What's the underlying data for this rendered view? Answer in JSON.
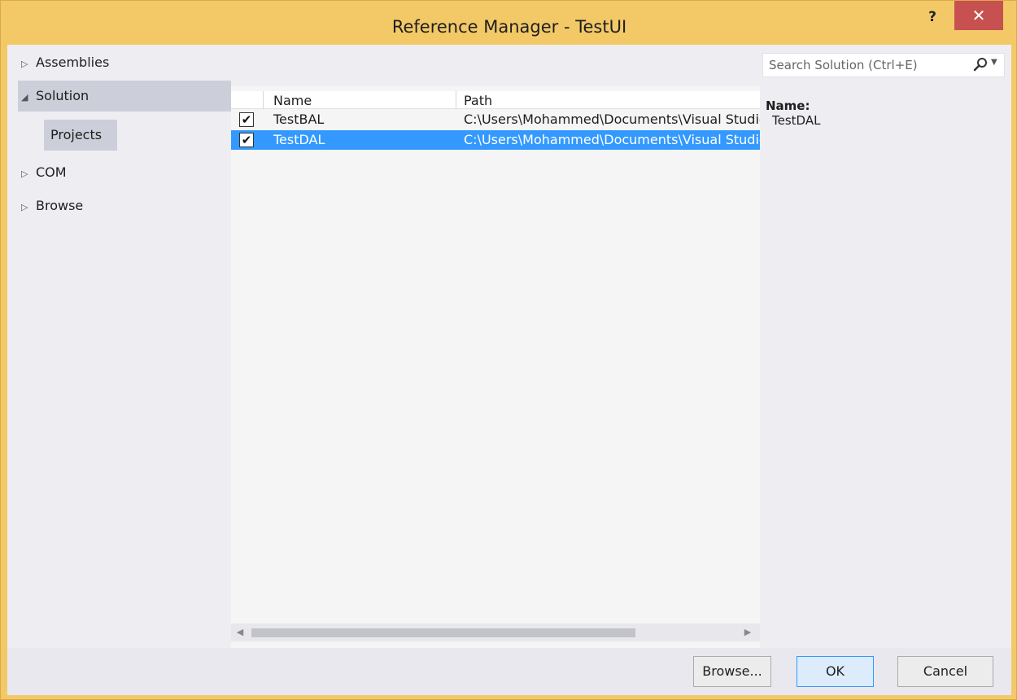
{
  "window": {
    "title": "Reference Manager - TestUI",
    "help_label": "?",
    "close_label": "✕"
  },
  "nav": {
    "assemblies": {
      "arrow": "▷",
      "label": "Assemblies"
    },
    "solution": {
      "arrow": "◢",
      "label": "Solution"
    },
    "projects": {
      "label": "Projects"
    },
    "com": {
      "arrow": "▷",
      "label": "COM"
    },
    "browse": {
      "arrow": "▷",
      "label": "Browse"
    }
  },
  "list": {
    "columns": {
      "name": "Name",
      "path": "Path"
    },
    "rows": [
      {
        "checked": "✔",
        "name": "TestBAL",
        "path": "C:\\Users\\Mohammed\\Documents\\Visual Studio"
      },
      {
        "checked": "✔",
        "name": "TestDAL",
        "path": "C:\\Users\\Mohammed\\Documents\\Visual Studio"
      }
    ],
    "scroll_left": "◀",
    "scroll_right": "▶"
  },
  "search": {
    "placeholder": "Search Solution (Ctrl+E)",
    "dropdown": "▼"
  },
  "details": {
    "name_label": "Name:",
    "name_value": "TestDAL"
  },
  "buttons": {
    "browse": "Browse...",
    "ok": "OK",
    "cancel": "Cancel"
  },
  "colors": {
    "title_bar": "#f3c967",
    "close": "#c75050",
    "selection": "#3399ff",
    "nav_selected": "#ccced9"
  }
}
